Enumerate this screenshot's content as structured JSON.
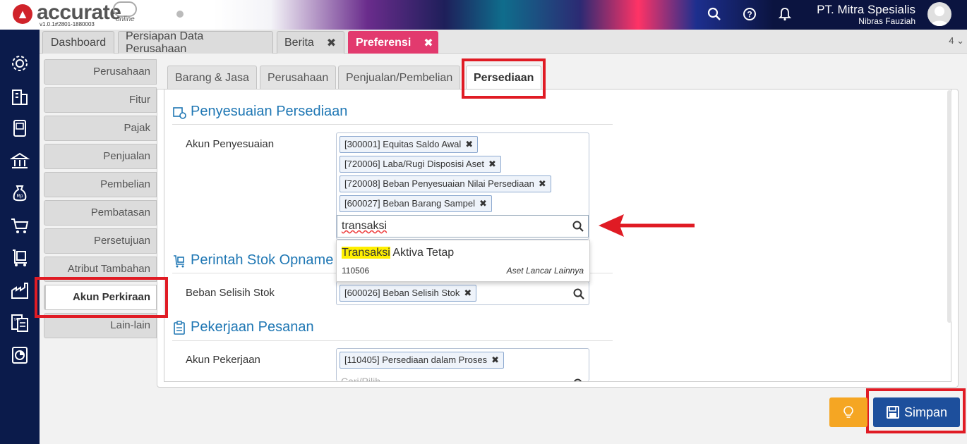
{
  "app": {
    "logo_text": "accurate",
    "logo_sub": "online",
    "version": "v1.0.1#2801-1880003"
  },
  "header": {
    "company": "PT. Mitra Spesialis",
    "user": "Nibras Fauziah",
    "icons": [
      "search-icon",
      "help-icon",
      "bell-icon",
      "avatar"
    ]
  },
  "sidebar": {
    "icons": [
      "gear-icon",
      "building-icon",
      "ledger-icon",
      "bank-icon",
      "money-bag-icon",
      "cart-icon",
      "delivery-cart-icon",
      "factory-icon",
      "tax-report-icon",
      "report-chart-icon"
    ]
  },
  "tabs": [
    {
      "label": "Dashboard",
      "closable": false
    },
    {
      "label": "Persiapan Data Perusahaan",
      "closable": false
    },
    {
      "label": "Berita",
      "closable": true
    },
    {
      "label": "Preferensi",
      "closable": true,
      "active": true
    }
  ],
  "tab_count": "4",
  "left_menu": [
    {
      "label": "Perusahaan"
    },
    {
      "label": "Fitur"
    },
    {
      "label": "Pajak"
    },
    {
      "label": "Penjualan"
    },
    {
      "label": "Pembelian"
    },
    {
      "label": "Pembatasan"
    },
    {
      "label": "Persetujuan"
    },
    {
      "label": "Atribut Tambahan"
    },
    {
      "label": "Akun Perkiraan",
      "active": true
    },
    {
      "label": "Lain-lain"
    }
  ],
  "sub_tabs": [
    {
      "label": "Barang & Jasa"
    },
    {
      "label": "Perusahaan"
    },
    {
      "label": "Penjualan/Pembelian"
    },
    {
      "label": "Persediaan",
      "active": true
    }
  ],
  "sections": {
    "penyesuaian": {
      "title": "Penyesuaian Persediaan",
      "label": "Akun Penyesuaian",
      "chips": [
        "[300001] Equitas Saldo Awal",
        "[720006] Laba/Rugi Disposisi Aset",
        "[720008] Beban Penyesuaian Nilai Persediaan",
        "[600027] Beban Barang Sampel"
      ],
      "search_value": "transaksi"
    },
    "opname": {
      "title": "Perintah Stok Opname",
      "label": "Beban Selisih Stok",
      "chips": [
        "[600026] Beban Selisih Stok"
      ]
    },
    "pekerjaan": {
      "title": "Pekerjaan Pesanan",
      "label": "Akun Pekerjaan",
      "chips": [
        "[110405] Persediaan dalam Proses"
      ],
      "placeholder": "Cari/Pilih..."
    }
  },
  "dropdown": {
    "highlight": "Transaksi",
    "rest": " Aktiva Tetap",
    "code": "110506",
    "category": "Aset Lancar Lainnya"
  },
  "buttons": {
    "save": "Simpan"
  },
  "colors": {
    "accent_tab": "#e23a6e",
    "sidebar": "#0b1b4b",
    "section_title": "#1f77b4",
    "save_button": "#1d4f9c",
    "bulb_button": "#f5a623",
    "annotation_red": "#e01b24",
    "highlight": "#ffef00"
  }
}
